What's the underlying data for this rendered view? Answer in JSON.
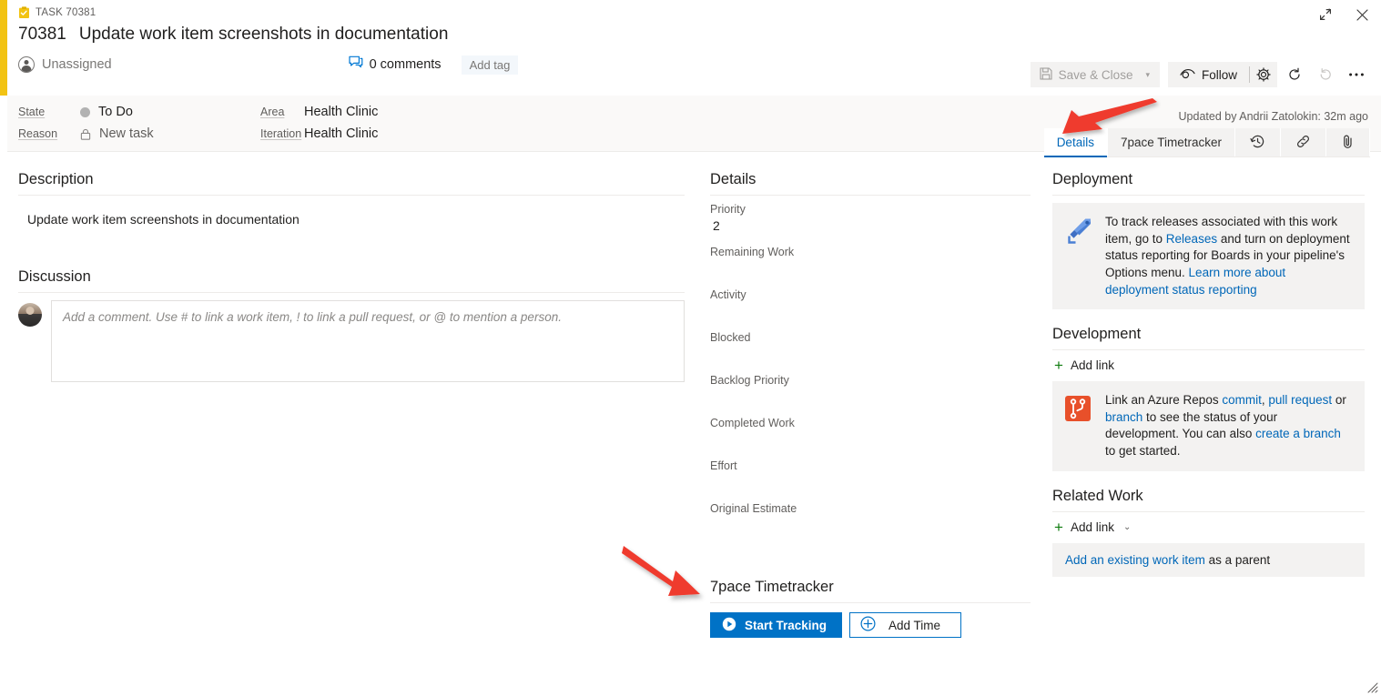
{
  "window": {
    "expand_icon": "expand-icon",
    "close_icon": "close-icon",
    "resize_grip": "resize-grip"
  },
  "header": {
    "type_icon": "task-icon",
    "type_label": "TASK 70381",
    "id": "70381",
    "title": "Update work item screenshots in documentation",
    "assignee": "Unassigned",
    "assignee_icon": "person-icon",
    "comments_icon": "comment-icon",
    "comments_label": "0 comments",
    "add_tag_label": "Add tag"
  },
  "toolbar": {
    "save_close_label": "Save & Close",
    "save_icon": "save-icon",
    "save_caret": "▾",
    "follow_label": "Follow",
    "follow_icon": "eye-icon",
    "settings_icon": "gear-icon",
    "refresh_icon": "refresh-icon",
    "undo_icon": "undo-icon",
    "more_icon": "ellipsis-icon"
  },
  "fields": {
    "state_label": "State",
    "state_value": "To Do",
    "state_color": "#b2b2b2",
    "reason_label": "Reason",
    "reason_value": "New task",
    "reason_icon": "lock-icon",
    "area_label": "Area",
    "area_value": "Health Clinic",
    "iteration_label": "Iteration",
    "iteration_value": "Health Clinic",
    "updated_by": "Updated by Andrii Zatolokin: 32m ago"
  },
  "tabs": [
    {
      "label": "Details",
      "name": "tab-details",
      "active": true,
      "icon": ""
    },
    {
      "label": "7pace Timetracker",
      "name": "tab-7pace-timetracker",
      "active": false,
      "icon": ""
    },
    {
      "label": "",
      "name": "tab-history",
      "active": false,
      "icon": "history-icon"
    },
    {
      "label": "",
      "name": "tab-links",
      "active": false,
      "icon": "link-icon"
    },
    {
      "label": "",
      "name": "tab-attachments",
      "active": false,
      "icon": "paperclip-icon"
    }
  ],
  "description": {
    "heading": "Description",
    "body": "Update work item screenshots in documentation"
  },
  "discussion": {
    "heading": "Discussion",
    "avatar": "user-avatar",
    "comment_placeholder": "Add a comment. Use # to link a work item, ! to link a pull request, or @ to mention a person."
  },
  "details": {
    "heading": "Details",
    "fields": [
      {
        "label": "Priority",
        "value": "2"
      },
      {
        "label": "Remaining Work",
        "value": ""
      },
      {
        "label": "Activity",
        "value": ""
      },
      {
        "label": "Blocked",
        "value": ""
      },
      {
        "label": "Backlog Priority",
        "value": ""
      },
      {
        "label": "Completed Work",
        "value": ""
      },
      {
        "label": "Effort",
        "value": ""
      },
      {
        "label": "Original Estimate",
        "value": ""
      }
    ]
  },
  "timetracker": {
    "heading": "7pace Timetracker",
    "start_label": "Start Tracking",
    "start_icon": "play-icon",
    "start_color": "#0072c6",
    "add_time_label": "Add Time",
    "add_time_icon": "plus-circle-icon"
  },
  "deployment": {
    "heading": "Deployment",
    "icon": "release-pipeline-icon",
    "text_1": "To track releases associated with this work item, go to ",
    "link_1": "Releases",
    "text_2": " and turn on deployment status reporting for Boards in your pipeline's Options menu. ",
    "link_2": "Learn more about deployment status reporting"
  },
  "development": {
    "heading": "Development",
    "add_link_label": "Add link",
    "icon": "azure-repos-icon",
    "text_1": "Link an Azure Repos ",
    "link_commit": "commit",
    "text_2": ", ",
    "link_pr": "pull request",
    "text_3": " or ",
    "link_branch": "branch",
    "text_4": " to see the status of your development. You can also ",
    "link_create_branch": "create a branch",
    "text_5": " to get started."
  },
  "related_work": {
    "heading": "Related Work",
    "add_link_label": "Add link",
    "add_link_caret": "⌄",
    "link_existing": "Add an existing work item",
    "suffix": " as a parent"
  },
  "annotations": {
    "arrow_color": "#ef3b2d",
    "arrow_tabs": "arrow-pointing-to-details-tab",
    "arrow_start": "arrow-pointing-to-start-tracking"
  }
}
